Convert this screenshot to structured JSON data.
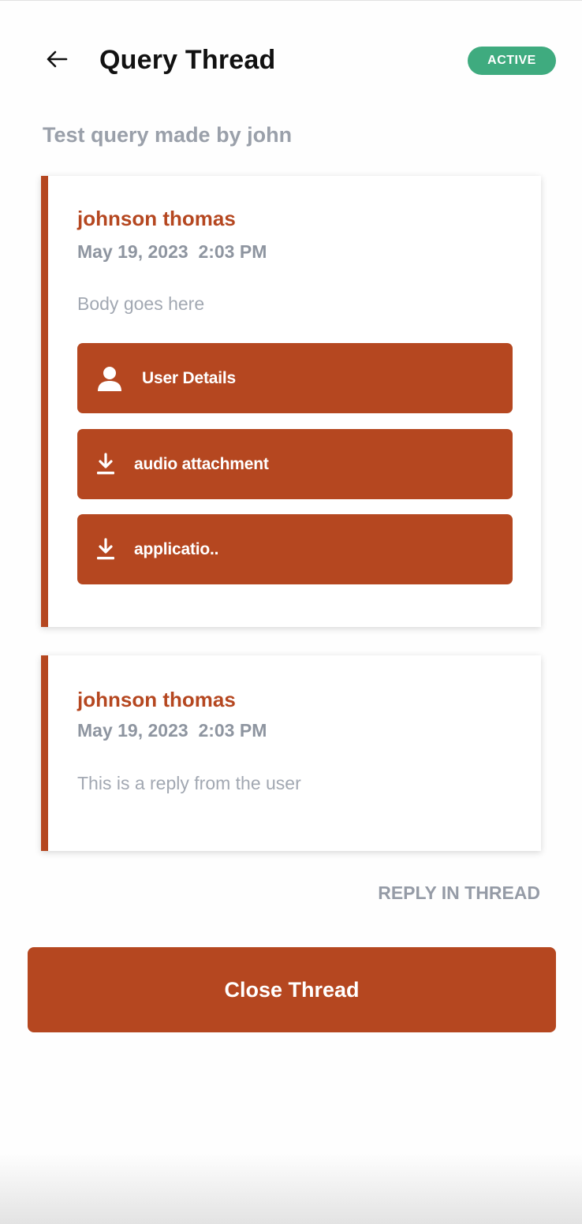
{
  "header": {
    "title": "Query Thread",
    "status": "ACTIVE",
    "back_icon": "arrow-left-icon"
  },
  "thread": {
    "subject": "Test query made by john"
  },
  "messages": [
    {
      "author": "johnson thomas",
      "timestamp": "May 19, 2023  2:03 PM",
      "body": "Body goes here",
      "actions": [
        {
          "label": "User Details",
          "icon": "user-icon"
        },
        {
          "label": "audio attachment",
          "icon": "download-icon"
        },
        {
          "label": "applicatio..",
          "icon": "download-icon"
        }
      ]
    },
    {
      "author": "johnson thomas",
      "timestamp": "May 19, 2023  2:03 PM",
      "body": "This is a reply from the user"
    }
  ],
  "footer": {
    "reply_label": "REPLY IN THREAD",
    "close_label": "Close Thread"
  },
  "colors": {
    "accent": "#b54720",
    "status_active": "#3fab7f",
    "muted_text": "#9aa0aa"
  }
}
